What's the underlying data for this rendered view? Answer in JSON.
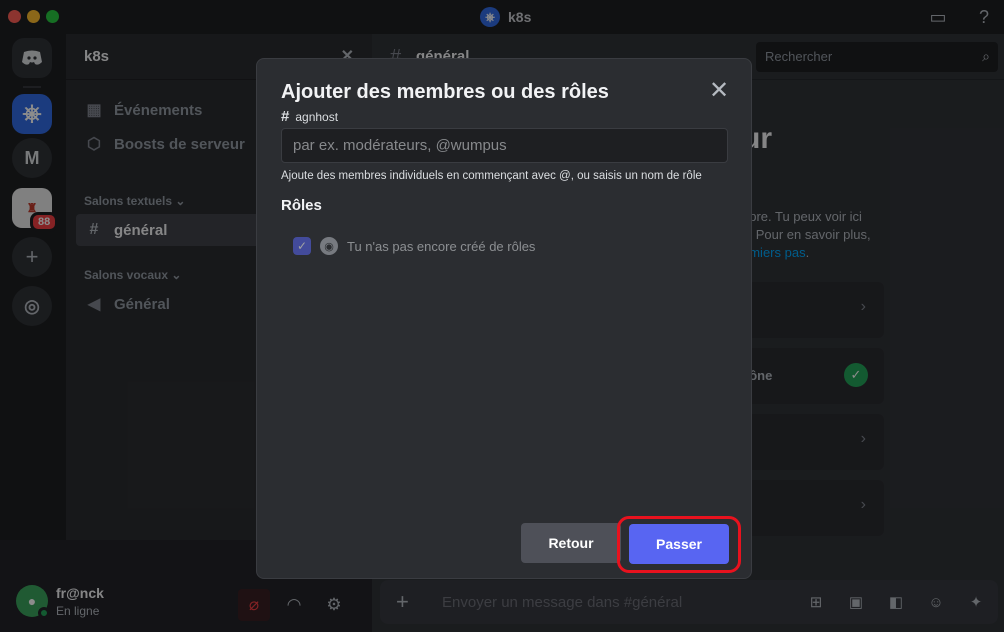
{
  "window": {
    "title": "k8s"
  },
  "rail": {
    "servers": [
      {
        "name": "discord-home",
        "label": ""
      },
      {
        "name": "k8s",
        "label": ""
      },
      {
        "name": "m",
        "label": "M"
      },
      {
        "name": "ehu",
        "label": ""
      }
    ],
    "badge": "88"
  },
  "sidebar": {
    "guild_name": "k8s",
    "items": [
      {
        "label": "Événements"
      },
      {
        "label": "Boosts de serveur"
      }
    ],
    "text_category": "Salons textuels",
    "text_channel": "général",
    "voice_category": "Salons vocaux",
    "voice_channel": "Général"
  },
  "user": {
    "name": "fr@nck",
    "status": "En ligne"
  },
  "main": {
    "channel": "général",
    "search_placeholder": "Rechercher",
    "welcome_fragment": "ur",
    "welcome_text_1": "opre. Tu peux voir ici",
    "welcome_text_2": "s. Pour en savoir plus,",
    "welcome_link": "emiers pas",
    "welcome_link_suffix": ".",
    "card_label": "cône",
    "composer_placeholder": "Envoyer un message dans #général"
  },
  "modal": {
    "title": "Ajouter des membres ou des rôles",
    "channel": "agnhost",
    "input_placeholder": "par ex. modérateurs, @wumpus",
    "hint": "Ajoute des membres individuels en commençant avec @, ou saisis un nom de rôle",
    "roles_heading": "Rôles",
    "role_empty": "Tu n'as pas encore créé de rôles",
    "back_label": "Retour",
    "skip_label": "Passer"
  },
  "colors": {
    "accent": "#5865f2",
    "highlight_ring": "#e8121e",
    "online": "#23a55a",
    "danger": "#f23f43"
  }
}
